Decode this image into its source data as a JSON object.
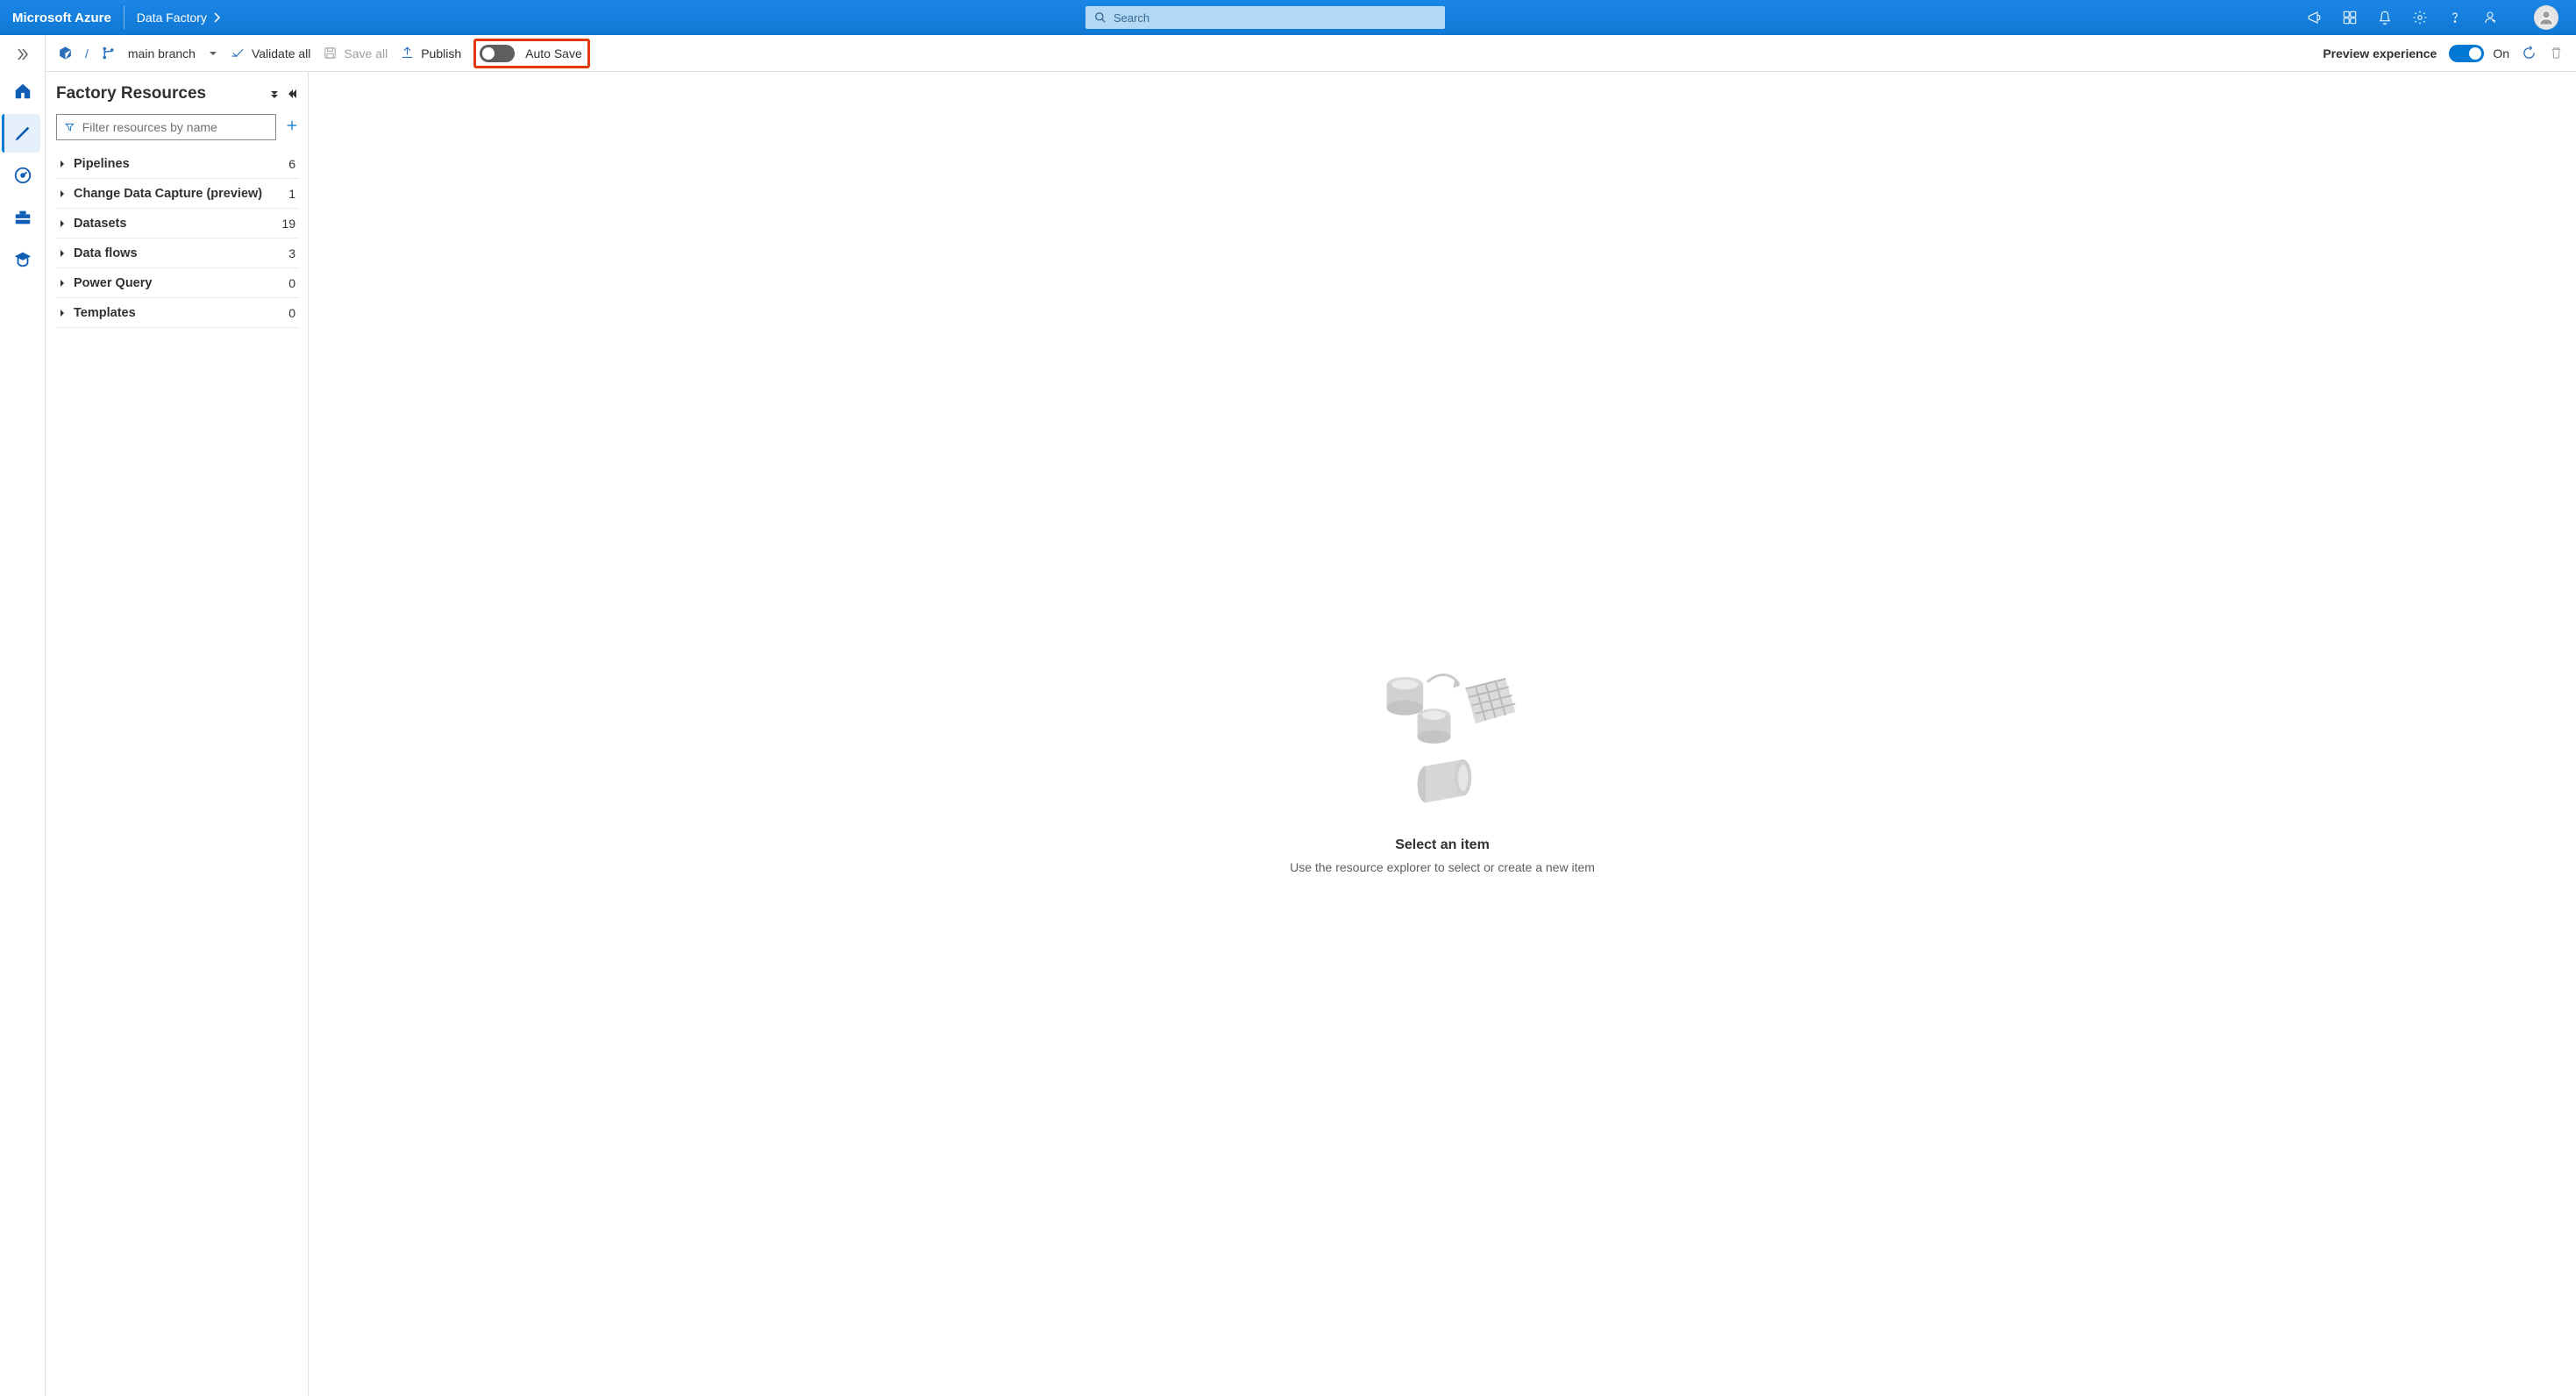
{
  "topbar": {
    "brand": "Microsoft Azure",
    "product": "Data Factory",
    "search_placeholder": "Search"
  },
  "toolbar": {
    "branch_name": "main branch",
    "validate_label": "Validate all",
    "save_all_label": "Save all",
    "publish_label": "Publish",
    "auto_save_label": "Auto Save",
    "preview_experience_label": "Preview experience",
    "preview_state_label": "On"
  },
  "resources": {
    "title": "Factory Resources",
    "filter_placeholder": "Filter resources by name",
    "items": [
      {
        "label": "Pipelines",
        "count": "6"
      },
      {
        "label": "Change Data Capture (preview)",
        "count": "1"
      },
      {
        "label": "Datasets",
        "count": "19"
      },
      {
        "label": "Data flows",
        "count": "3"
      },
      {
        "label": "Power Query",
        "count": "0"
      },
      {
        "label": "Templates",
        "count": "0"
      }
    ]
  },
  "canvas": {
    "title": "Select an item",
    "subtitle": "Use the resource explorer to select or create a new item"
  }
}
